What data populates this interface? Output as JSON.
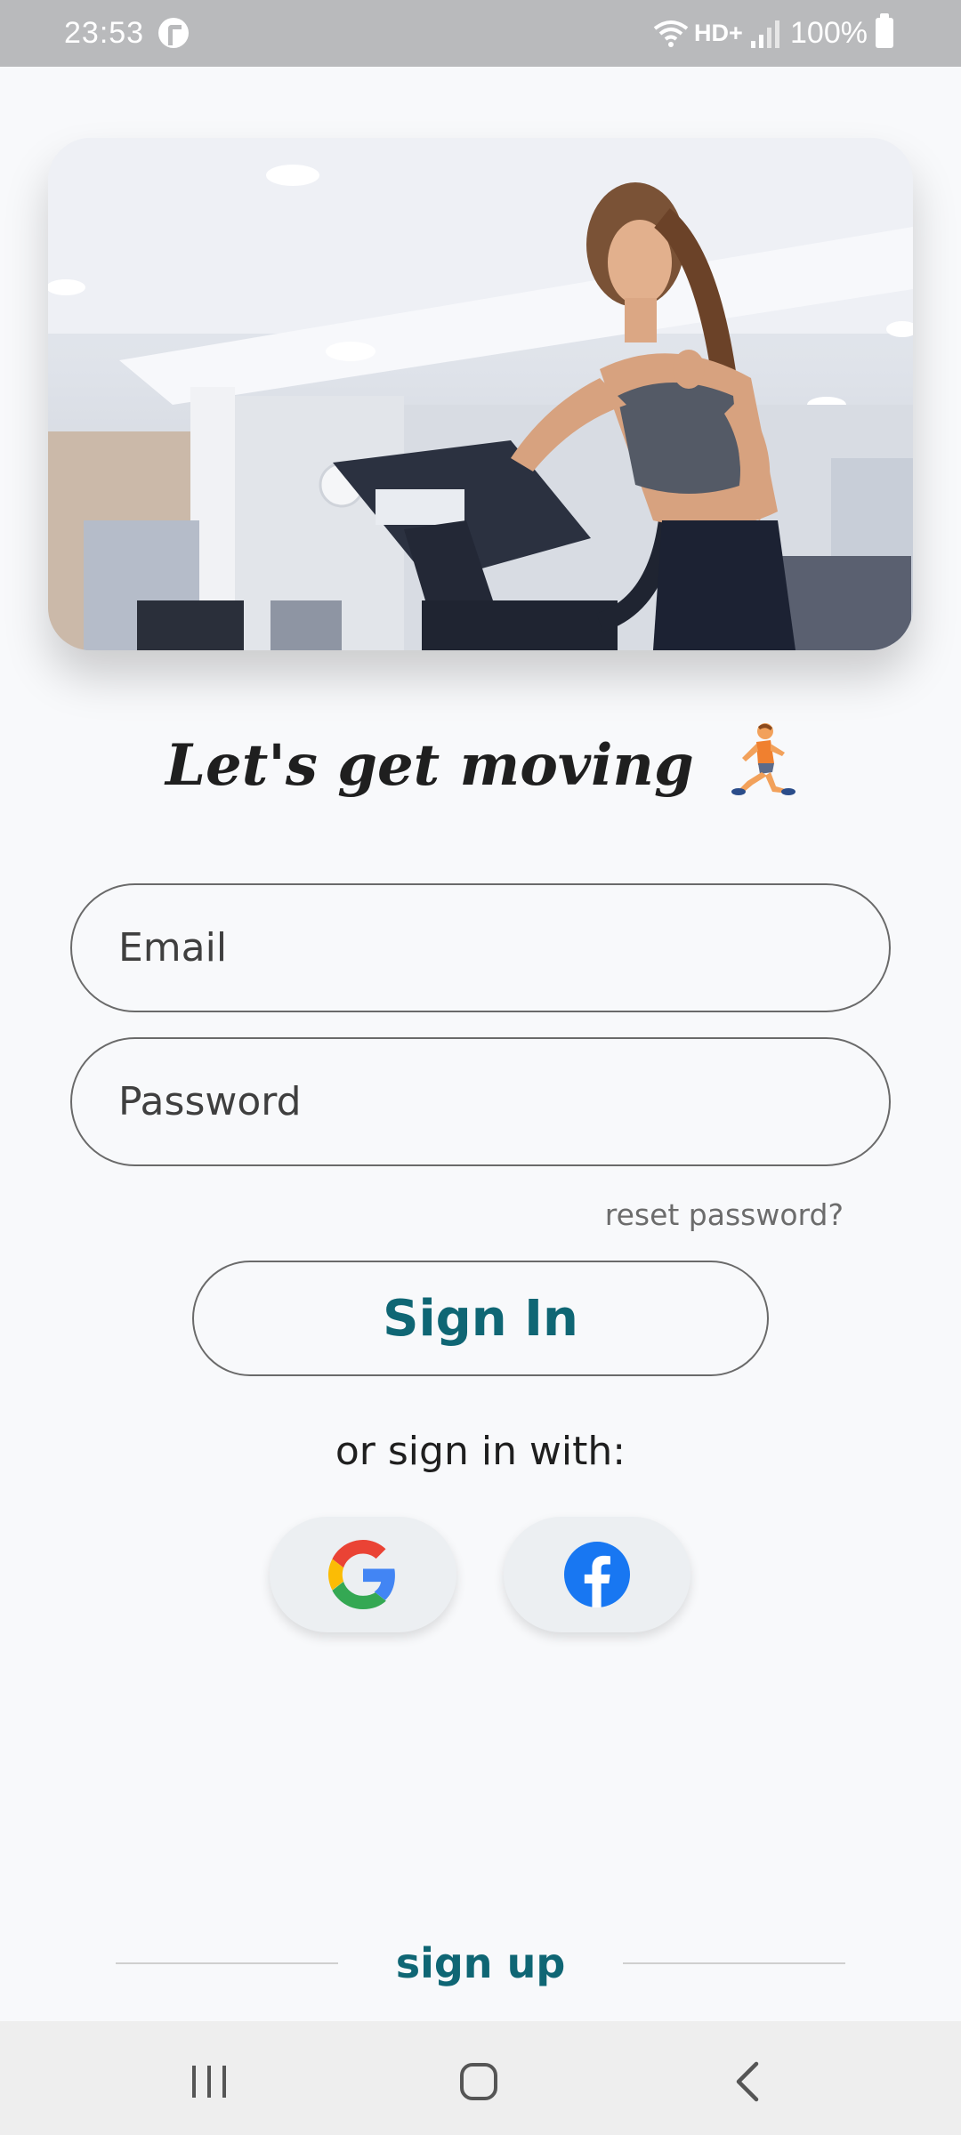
{
  "status_bar": {
    "time": "23:53",
    "network": "HD+",
    "battery": "100%"
  },
  "hero": {
    "image_description_icon": "gym-woman-elliptical-photo"
  },
  "headline": {
    "text": "Let's get moving",
    "emoji_icon": "runner-icon"
  },
  "form": {
    "email_placeholder": "Email",
    "password_placeholder": "Password",
    "reset_label": "reset password?",
    "sign_in_label": "Sign In"
  },
  "social": {
    "prompt": "or sign in with:",
    "providers": [
      "google-icon",
      "facebook-icon"
    ]
  },
  "footer": {
    "sign_up_label": "sign up"
  },
  "colors": {
    "accent": "#0f6674",
    "background": "#f8f9fb",
    "status_bar": "#b9babc",
    "facebook": "#1877f2"
  }
}
